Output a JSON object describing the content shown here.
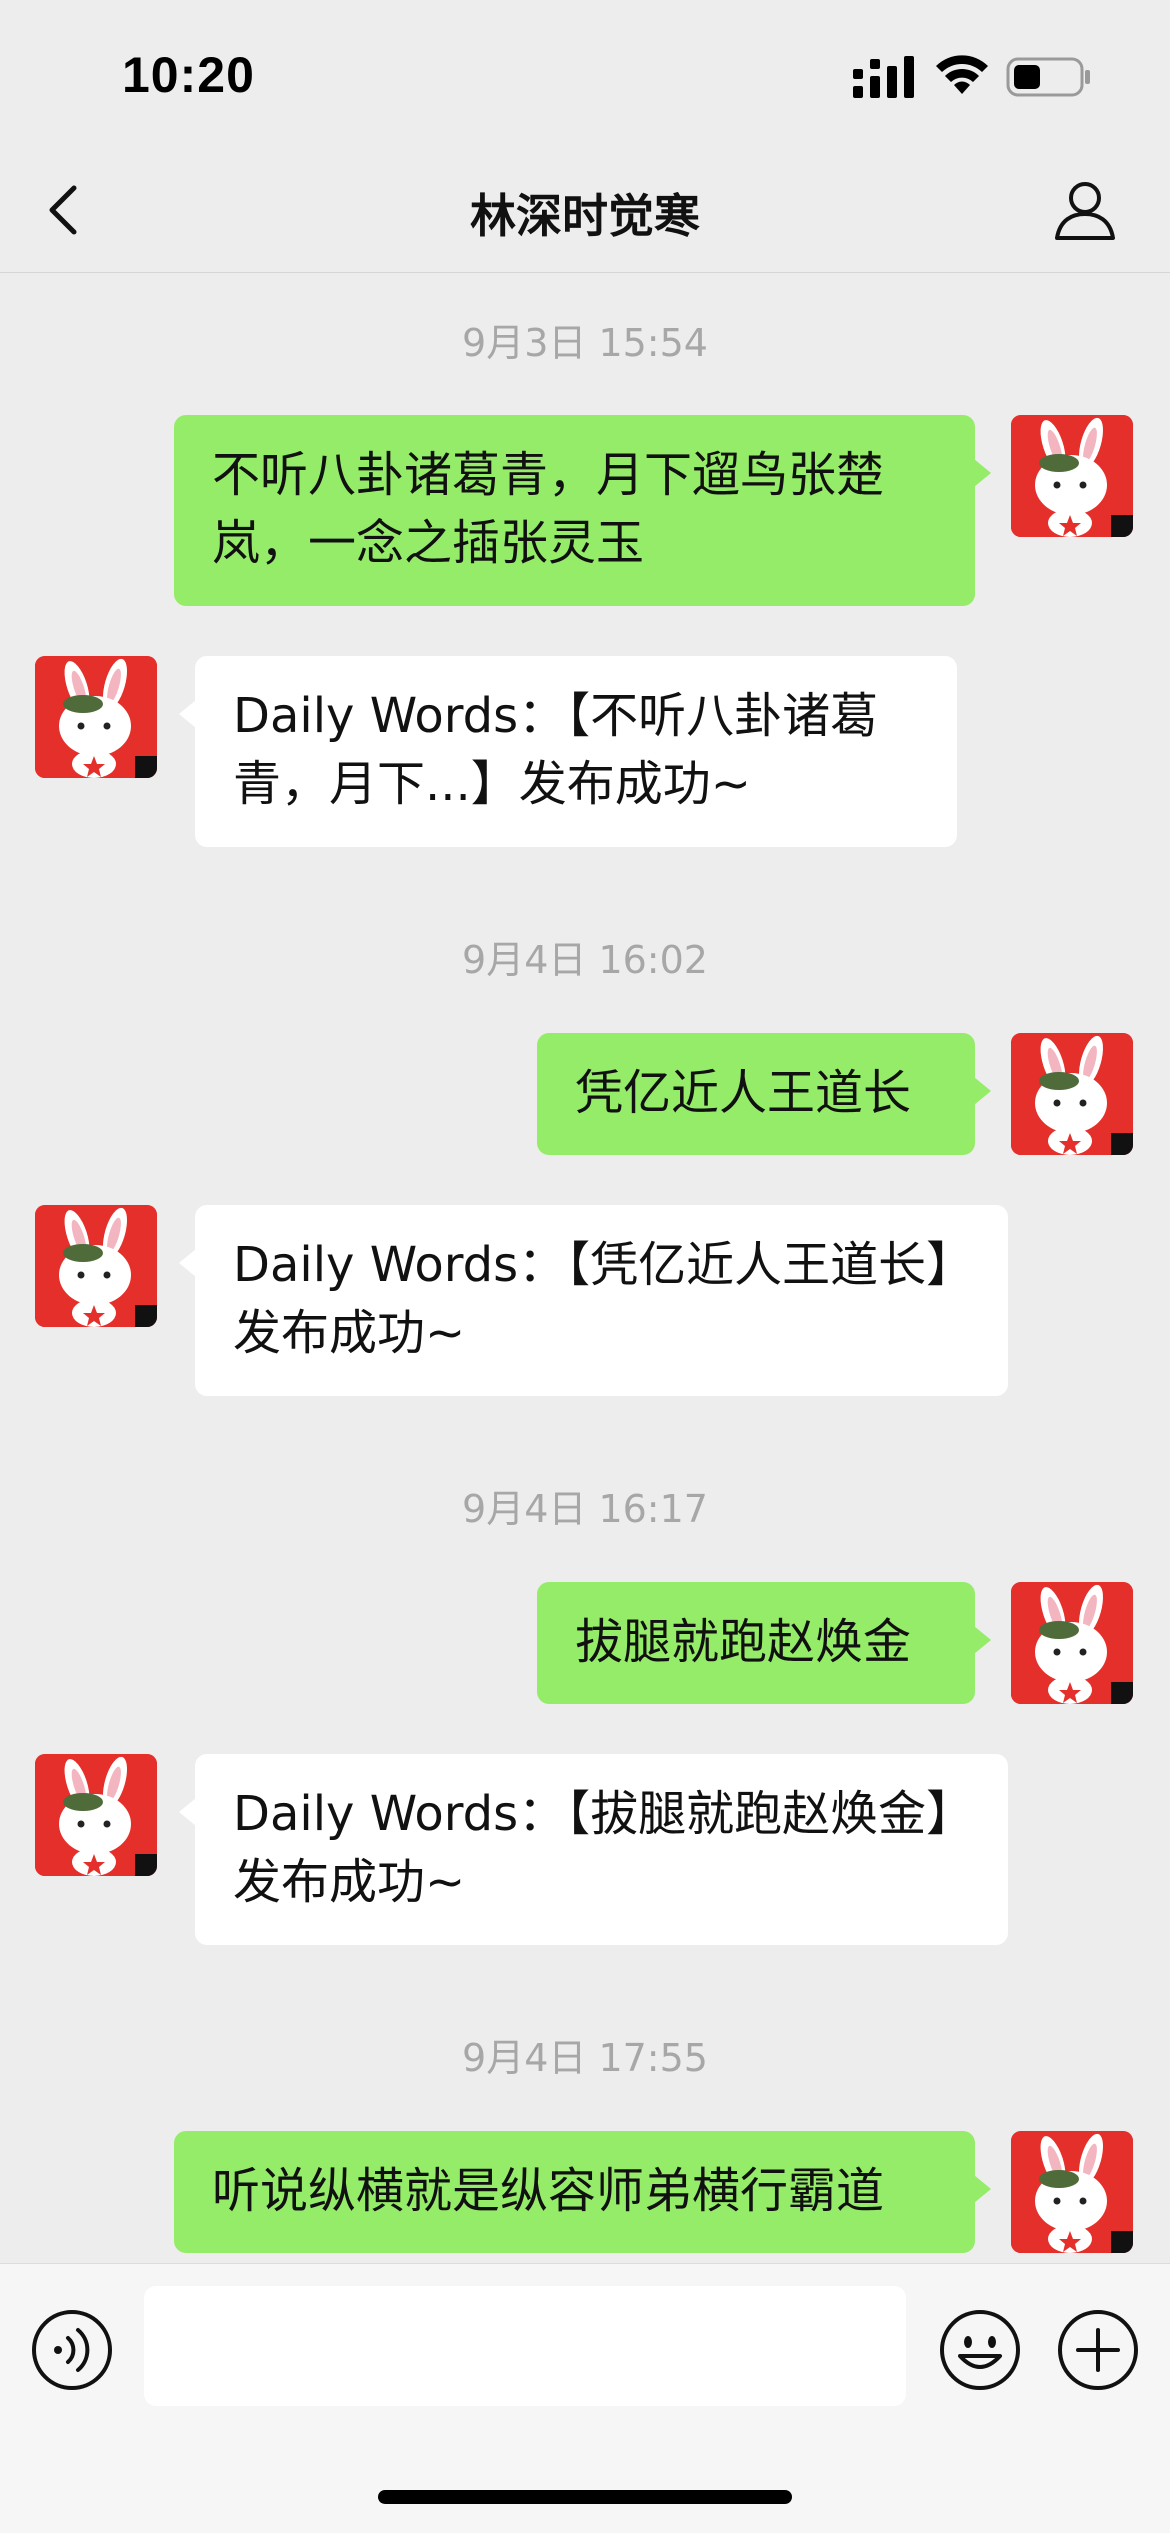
{
  "status_bar": {
    "time": "10:20"
  },
  "nav": {
    "title": "林深时觉寒",
    "back_icon": "chevron-left-icon",
    "profile_icon": "person-icon"
  },
  "messages": [
    {
      "type": "timestamp",
      "text": "9月3日 15:54"
    },
    {
      "type": "outgoing",
      "text": "不听八卦诸葛青，月下遛鸟张楚岚，一念之插张灵玉"
    },
    {
      "type": "incoming",
      "text": "Daily Words：【不听八卦诸葛青，月下...】发布成功~"
    },
    {
      "type": "timestamp",
      "text": "9月4日 16:02"
    },
    {
      "type": "outgoing",
      "text": "凭亿近人王道长"
    },
    {
      "type": "incoming",
      "text": "Daily Words：【凭亿近人王道长】发布成功~"
    },
    {
      "type": "timestamp",
      "text": "9月4日 16:17"
    },
    {
      "type": "outgoing",
      "text": "拔腿就跑赵焕金"
    },
    {
      "type": "incoming",
      "text": "Daily Words：【拔腿就跑赵焕金】发布成功~"
    },
    {
      "type": "timestamp",
      "text": "9月4日 17:55"
    },
    {
      "type": "outgoing",
      "text": "听说纵横就是纵容师弟横行霸道"
    }
  ],
  "input_bar": {
    "placeholder": "",
    "voice_icon": "voice-icon",
    "emoji_icon": "emoji-icon",
    "plus_icon": "plus-icon"
  },
  "colors": {
    "background": "#ededed",
    "outgoing_bubble": "#95ec69",
    "incoming_bubble": "#ffffff",
    "avatar_red": "#e42f2a",
    "timestamp": "#a7a7a7"
  }
}
